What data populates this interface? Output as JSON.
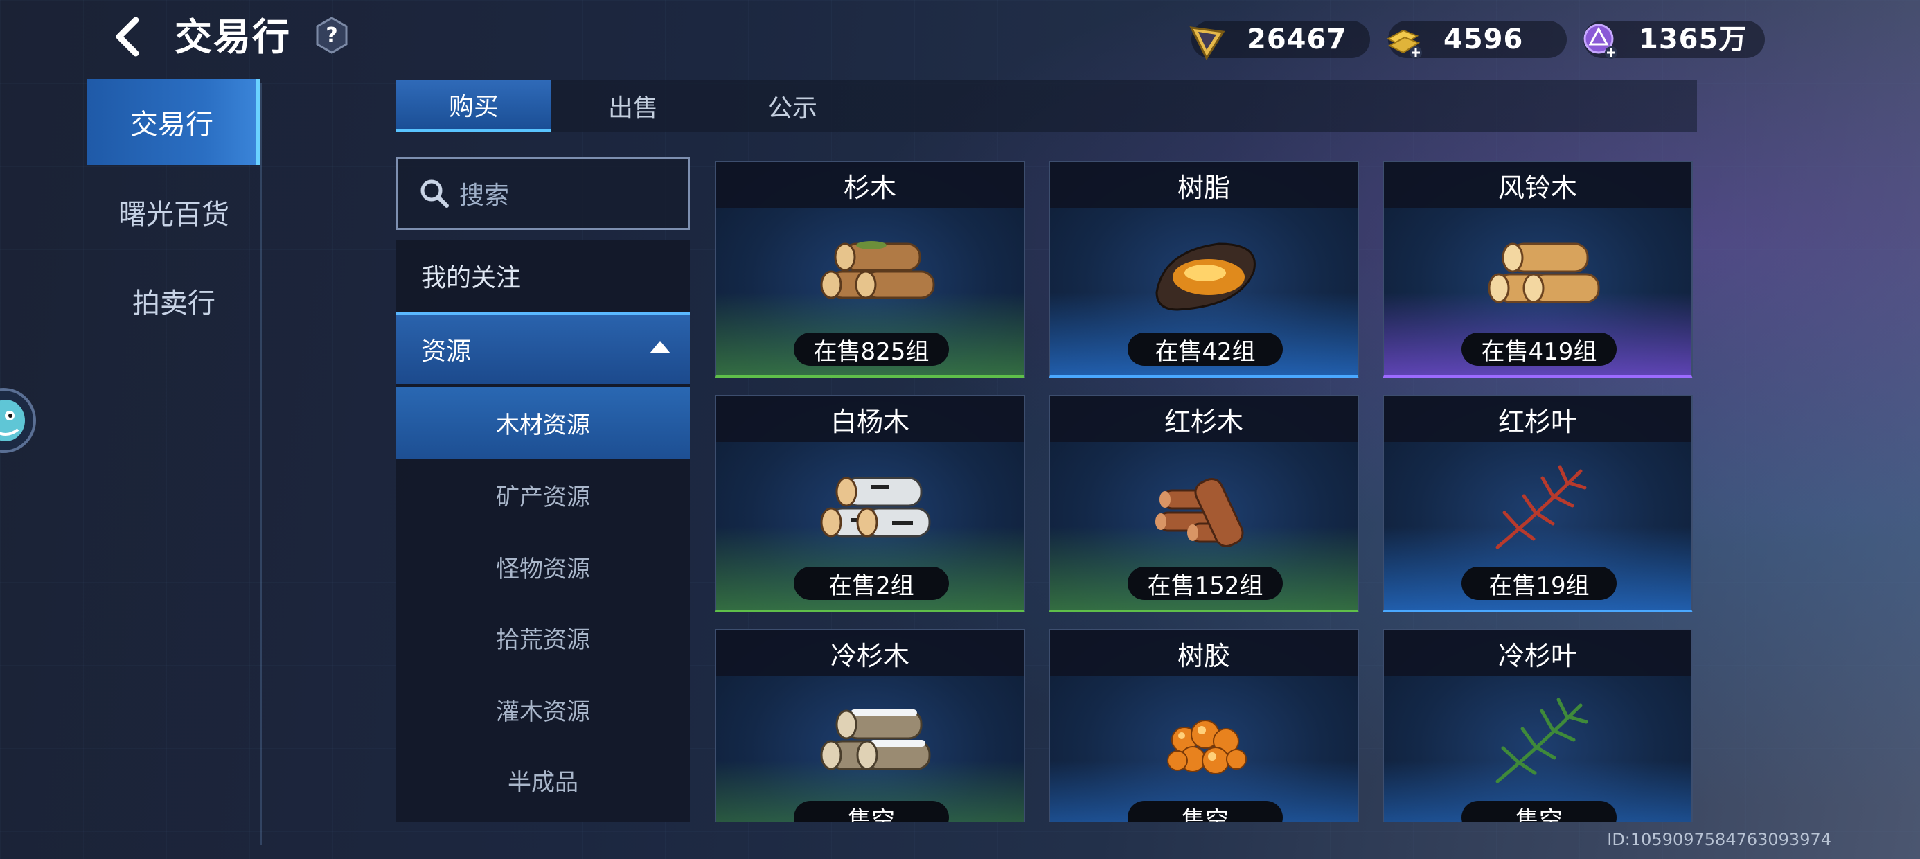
{
  "header": {
    "title": "交易行",
    "help_label": "?"
  },
  "currencies": [
    {
      "icon": "gold-crystal-icon",
      "value": "26467"
    },
    {
      "icon": "gold-bars-plus-icon",
      "value": "4596"
    },
    {
      "icon": "purple-orb-plus-icon",
      "value": "1365万"
    }
  ],
  "left_nav": [
    {
      "label": "交易行",
      "active": true
    },
    {
      "label": "曙光百货",
      "active": false
    },
    {
      "label": "拍卖行",
      "active": false
    }
  ],
  "tabs": [
    {
      "label": "购买",
      "active": true
    },
    {
      "label": "出售",
      "active": false
    },
    {
      "label": "公示",
      "active": false
    }
  ],
  "search": {
    "placeholder": "搜索"
  },
  "categories": {
    "favorites": "我的关注",
    "resources": "资源",
    "subcategories": [
      "木材资源",
      "矿产资源",
      "怪物资源",
      "拾荒资源",
      "灌木资源",
      "半成品"
    ],
    "active_sub": "木材资源"
  },
  "items": [
    {
      "name": "杉木",
      "sale": "在售825组",
      "rarity": "green",
      "icon": "logs-icon"
    },
    {
      "name": "树脂",
      "sale": "在售42组",
      "rarity": "blue",
      "icon": "resin-icon"
    },
    {
      "name": "风铃木",
      "sale": "在售419组",
      "rarity": "purple",
      "icon": "logs-icon"
    },
    {
      "name": "白杨木",
      "sale": "在售2组",
      "rarity": "green",
      "icon": "birch-logs-icon"
    },
    {
      "name": "红杉木",
      "sale": "在售152组",
      "rarity": "green",
      "icon": "redwood-logs-icon"
    },
    {
      "name": "红杉叶",
      "sale": "在售19组",
      "rarity": "blue",
      "icon": "red-leaf-icon"
    },
    {
      "name": "冷杉木",
      "sale": "售空",
      "rarity": "green",
      "icon": "snowy-logs-icon"
    },
    {
      "name": "树胶",
      "sale": "售空",
      "rarity": "blue",
      "icon": "amber-gum-icon"
    },
    {
      "name": "冷杉叶",
      "sale": "售空",
      "rarity": "blue",
      "icon": "fir-leaf-icon"
    }
  ],
  "footer": {
    "id_text": "ID:1059097584763093974"
  }
}
